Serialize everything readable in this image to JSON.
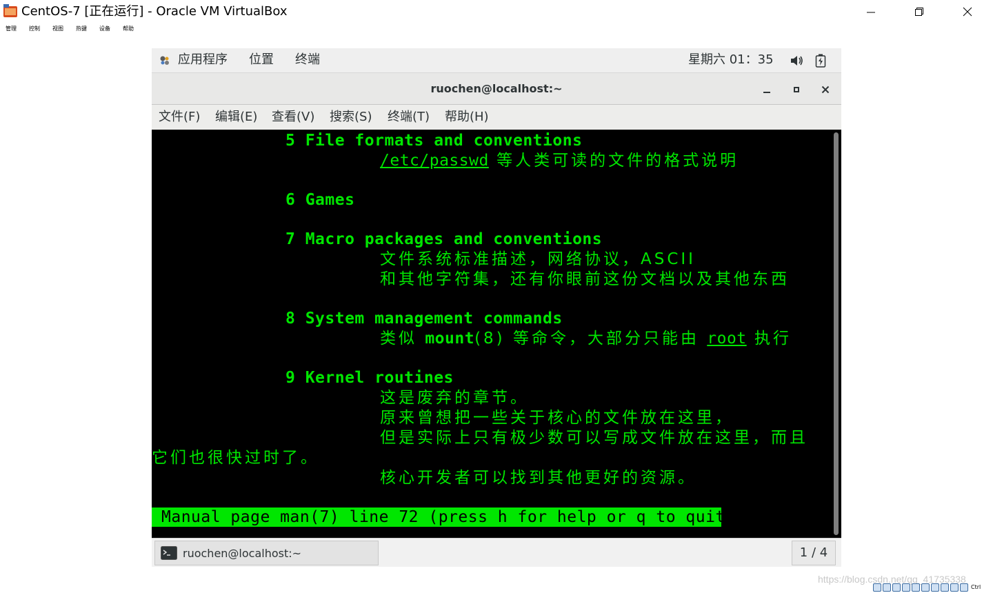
{
  "host": {
    "title": "CentOS-7 [正在运行] - Oracle VM VirtualBox",
    "menu": [
      "管理",
      "控制",
      "视图",
      "热键",
      "设备",
      "帮助"
    ],
    "host_key": "Ctrl",
    "watermark": "https://blog.csdn.net/qq_41735338"
  },
  "guest_topbar": {
    "applications": "应用程序",
    "places": "位置",
    "terminal": "终端",
    "clock": "星期六 01：35"
  },
  "terminal": {
    "title": "ruochen@localhost:~",
    "menu": [
      "文件(F)",
      "编辑(E)",
      "查看(V)",
      "搜索(S)",
      "终端(T)",
      "帮助(H)"
    ],
    "lines": {
      "s5_title": "5 File formats and conventions",
      "s5_path": "/etc/passwd",
      "s5_desc": " 等人类可读的文件的格式说明",
      "s6_title": "6 Games",
      "s7_title": "7 Macro packages and conventions",
      "s7_desc1": "文件系统标准描述，网络协议，ASCII",
      "s7_desc2": "和其他字符集，还有你眼前这份文档以及其他东西",
      "s8_title": "8 System management commands",
      "s8_pre": "类似 ",
      "s8_cmd": "mount",
      "s8_mid": "(8) 等命令，大部分只能由 ",
      "s8_root": "root",
      "s8_post": " 执行",
      "s9_title": "9 Kernel routines",
      "s9_desc1": "这是废弃的章节。",
      "s9_desc2": "原来曾想把一些关于核心的文件放在这里，",
      "s9_desc3": "但是实际上只有极少数可以写成文件放在这里，而且",
      "s9_desc4": "它们也很快过时了。",
      "s9_desc5": "核心开发者可以找到其他更好的资源。"
    },
    "status_line": "Manual page man(7) line 72 (press h for help or q to quit)",
    "text_color": "#00e600",
    "background_color": "#000000"
  },
  "taskbar": {
    "task_label": "ruochen@localhost:~",
    "workspace": "1 / 4"
  }
}
